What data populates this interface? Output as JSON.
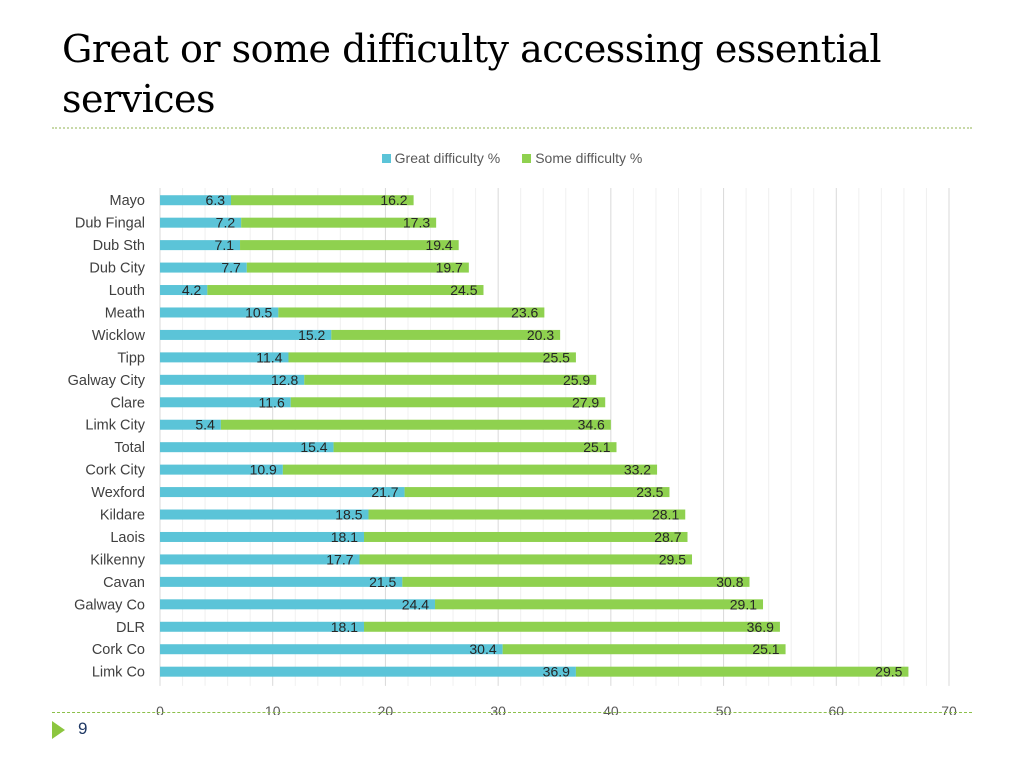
{
  "slide": {
    "title": "Great or some difficulty accessing essential services",
    "page_number": "9"
  },
  "colors": {
    "great": "#5bc4d8",
    "some": "#8fd14f",
    "grid": "#e4e4e4",
    "text": "#404040",
    "accent": "#8cc63f"
  },
  "chart_data": {
    "type": "bar",
    "orientation": "horizontal",
    "stacked": true,
    "title": "",
    "xlabel": "",
    "ylabel": "",
    "xlim": [
      0,
      70
    ],
    "xticks": [
      0,
      10,
      20,
      30,
      40,
      50,
      60,
      70
    ],
    "grid": true,
    "legend_position": "top",
    "categories": [
      "Mayo",
      "Dub Fingal",
      "Dub Sth",
      "Dub City",
      "Louth",
      "Meath",
      "Wicklow",
      "Tipp",
      "Galway City",
      "Clare",
      "Limk City",
      "Total",
      "Cork City",
      "Wexford",
      "Kildare",
      "Laois",
      "Kilkenny",
      "Cavan",
      "Galway Co",
      "DLR",
      "Cork Co",
      "Limk Co"
    ],
    "series": [
      {
        "name": "Great difficulty %",
        "values": [
          6.3,
          7.2,
          7.1,
          7.7,
          4.2,
          10.5,
          15.2,
          11.4,
          12.8,
          11.6,
          5.4,
          15.4,
          10.9,
          21.7,
          18.5,
          18.1,
          17.7,
          21.5,
          24.4,
          18.1,
          30.4,
          36.9
        ]
      },
      {
        "name": "Some difficulty %",
        "values": [
          16.2,
          17.3,
          19.4,
          19.7,
          24.5,
          23.6,
          20.3,
          25.5,
          25.9,
          27.9,
          34.6,
          25.1,
          33.2,
          23.5,
          28.1,
          28.7,
          29.5,
          30.8,
          29.1,
          36.9,
          25.1,
          29.5
        ]
      }
    ]
  }
}
